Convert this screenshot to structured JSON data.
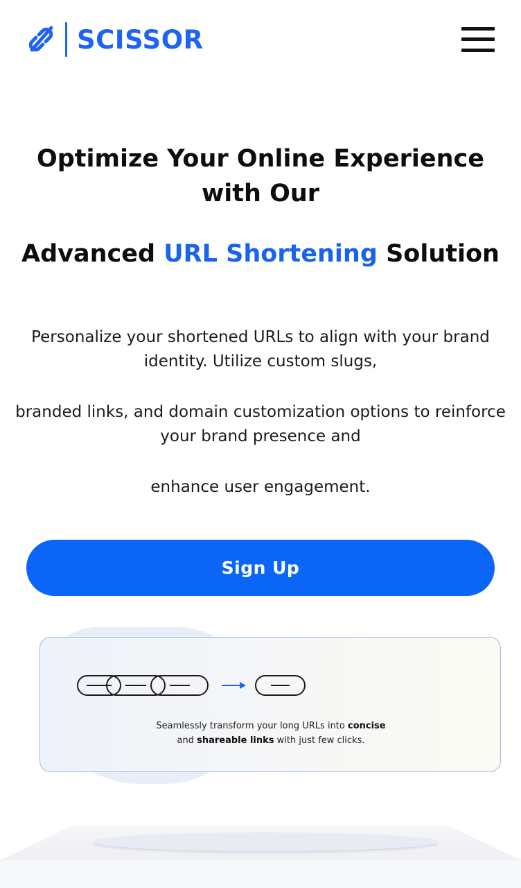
{
  "header": {
    "logo_text": "SCISSOR",
    "logo_icon": "link-slash-icon",
    "menu_icon": "hamburger-menu-icon"
  },
  "hero": {
    "title": "Optimize Your Online Experience with Our",
    "subtitle_before": "Advanced ",
    "subtitle_accent": "URL Shortening",
    "subtitle_after": " Solution",
    "description_1": "Personalize your shortened URLs to align with your brand identity. Utilize custom slugs,",
    "description_2": "branded links, and domain customization options to reinforce your brand presence and",
    "description_3": "enhance user engagement."
  },
  "cta": {
    "signup_label": "Sign Up"
  },
  "illustration": {
    "caption_part_1": "Seamlessly transform your long URLs into ",
    "caption_bold_1": "concise",
    "caption_part_2": "and ",
    "caption_bold_2": "shareable links",
    "caption_part_3": " with just few clicks."
  },
  "colors": {
    "brand_blue": "#1e63f2",
    "button_blue": "#0b66f8",
    "accent_text": "#1a63ef"
  }
}
